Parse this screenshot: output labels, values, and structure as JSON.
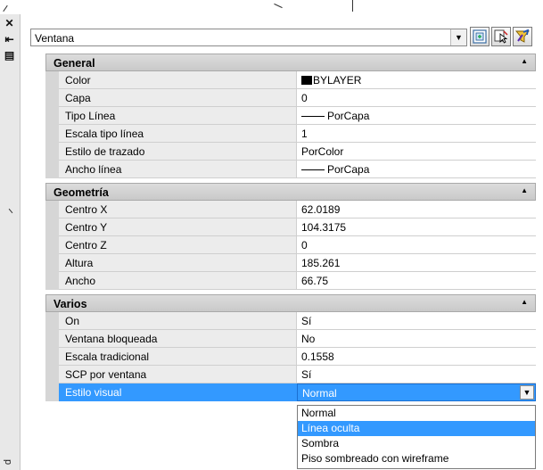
{
  "palette": {
    "close_glyph": "✕",
    "autohide_glyph": "⇤",
    "props_glyph": "▤",
    "vertical_label": "d"
  },
  "selector": {
    "value": "Ventana"
  },
  "toolbar": {
    "icons": [
      "toggle-pickadd-icon",
      "select-objects-icon",
      "quick-select-icon"
    ]
  },
  "sections": [
    {
      "title": "General",
      "rows": [
        {
          "name": "Color",
          "value": "BYLAYER"
        },
        {
          "name": "Capa",
          "value": "0"
        },
        {
          "name": "Tipo Línea",
          "value": "PorCapa"
        },
        {
          "name": "Escala tipo línea",
          "value": "1"
        },
        {
          "name": "Estilo de trazado",
          "value": "PorColor"
        },
        {
          "name": "Ancho línea",
          "value": "PorCapa"
        }
      ]
    },
    {
      "title": "Geometría",
      "rows": [
        {
          "name": "Centro X",
          "value": "62.0189"
        },
        {
          "name": "Centro Y",
          "value": "104.3175"
        },
        {
          "name": "Centro Z",
          "value": "0"
        },
        {
          "name": "Altura",
          "value": "185.261"
        },
        {
          "name": "Ancho",
          "value": "66.75"
        }
      ]
    },
    {
      "title": "Varios",
      "rows": [
        {
          "name": "On",
          "value": "Sí"
        },
        {
          "name": "Ventana bloqueada",
          "value": "No"
        },
        {
          "name": "Escala tradicional",
          "value": "0.1558"
        },
        {
          "name": "SCP por ventana",
          "value": "Sí"
        },
        {
          "name": "Estilo visual",
          "value": "Normal"
        }
      ]
    }
  ],
  "dropdown": {
    "options": [
      "Normal",
      "Línea oculta",
      "Sombra",
      "Piso sombreado con wireframe"
    ],
    "highlighted_index": 1
  },
  "colors": {
    "selection": "#3399ff",
    "section_header": "#d0d0d0",
    "name_cell": "#ececec"
  }
}
